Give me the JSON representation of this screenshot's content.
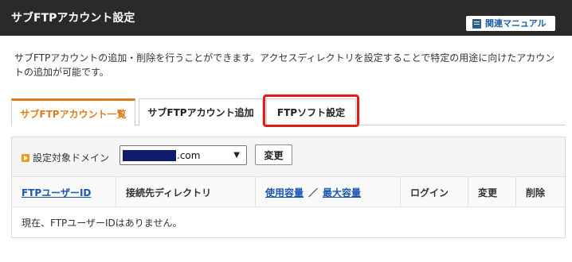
{
  "header": {
    "title": "サブFTPアカウント設定",
    "manual_label": "関連マニュアル"
  },
  "description": "サブFTPアカウントの追加・削除を行うことができます。アクセスディレクトリを設定することで特定の用途に向けたアカウントの追加が可能です。",
  "tabs": [
    {
      "label": "サブFTPアカウント一覧",
      "active": true
    },
    {
      "label": "サブFTPアカウント追加",
      "active": false
    },
    {
      "label": "FTPソフト設定",
      "active": false,
      "highlighted": true
    }
  ],
  "domain": {
    "label": "設定対象ドメイン",
    "selected_suffix": ".com",
    "change_label": "変更"
  },
  "table": {
    "headers": {
      "ftp_user_id": "FTPユーザーID",
      "directory": "接続先ディレクトリ",
      "usage": "使用容量",
      "separator": "／",
      "max_capacity": "最大容量",
      "login": "ログイン",
      "change": "変更",
      "delete": "削除"
    },
    "empty_message": "現在、FTPユーザーIDはありません。"
  },
  "colors": {
    "header_bg": "#2a2a2a",
    "accent_orange": "#e07a1c",
    "highlight_red": "#e41b1b",
    "link_blue": "#1a56b0",
    "domain_mask": "#101d6e"
  }
}
